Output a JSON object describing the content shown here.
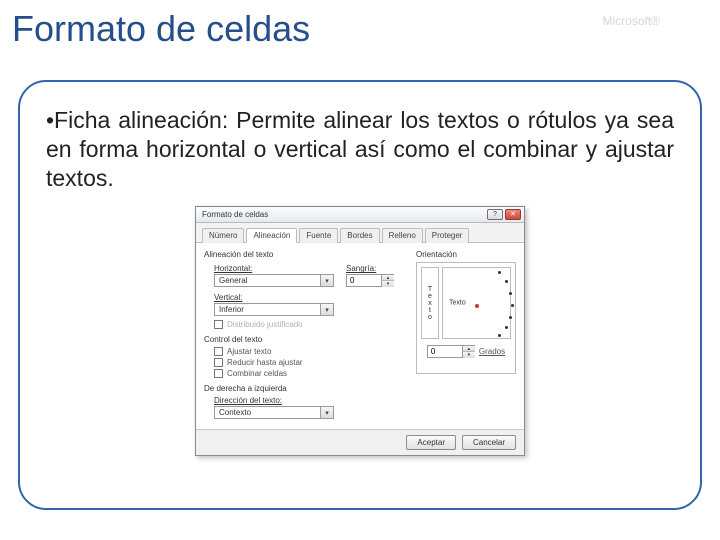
{
  "slide": {
    "title": "Formato de celdas",
    "brand": "Microsoft®",
    "bullet": "•Ficha alineación: Permite alinear los textos o rótulos ya sea en forma horizontal o vertical así como el combinar y ajustar textos."
  },
  "dialog": {
    "title": "Formato de celdas",
    "tabs": {
      "numero": "Número",
      "alineacion": "Alineación",
      "fuente": "Fuente",
      "bordes": "Bordes",
      "relleno": "Relleno",
      "proteger": "Proteger"
    },
    "align_section": "Alineación del texto",
    "horizontal_label": "Horizontal:",
    "horizontal_value": "General",
    "sangria_label": "Sangría:",
    "sangria_value": "0",
    "vertical_label": "Vertical:",
    "vertical_value": "Inferior",
    "dist_just": "Distribuido justificado",
    "control_section": "Control del texto",
    "ajustar": "Ajustar texto",
    "reducir": "Reducir hasta ajustar",
    "combinar": "Combinar celdas",
    "rtl_section": "De derecha a izquierda",
    "dir_label": "Dirección del texto:",
    "dir_value": "Contexto",
    "orientation": "Orientación",
    "vertical_text": "Texto",
    "dial_text": "Texto",
    "grados_value": "0",
    "grados_label": "Grados",
    "accept": "Aceptar",
    "cancel": "Cancelar"
  }
}
